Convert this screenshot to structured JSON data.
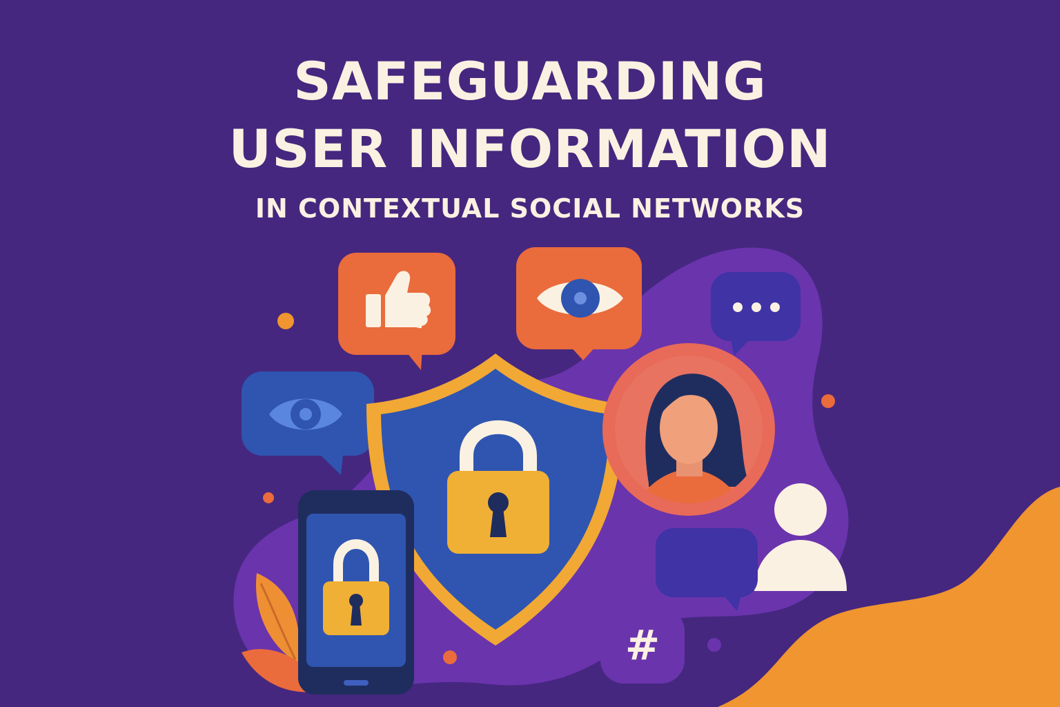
{
  "poster": {
    "title_line1": "SAFEGUARDING",
    "title_line2": "USER INFORMATION",
    "subtitle": "IN CONTEXTUAL SOCIAL NETWORKS",
    "hashtag_symbol": "#"
  },
  "colors": {
    "background": "#45277f",
    "blob_purple": "#6a34ad",
    "accent_orange": "#ea6b3c",
    "accent_amber": "#f0952f",
    "shield_blue": "#2f55b0",
    "shield_rim": "#f1a835",
    "lock_gold": "#f0b035",
    "text_cream": "#fbf1e2",
    "navy": "#1f2d5e"
  },
  "icons": [
    "thumbs-up-icon",
    "eye-icon",
    "ellipsis-icon",
    "shield-icon",
    "padlock-icon",
    "smartphone-icon",
    "avatar-icon",
    "user-icon",
    "hashtag-icon",
    "leaf-icon",
    "chat-bubble-icon"
  ]
}
